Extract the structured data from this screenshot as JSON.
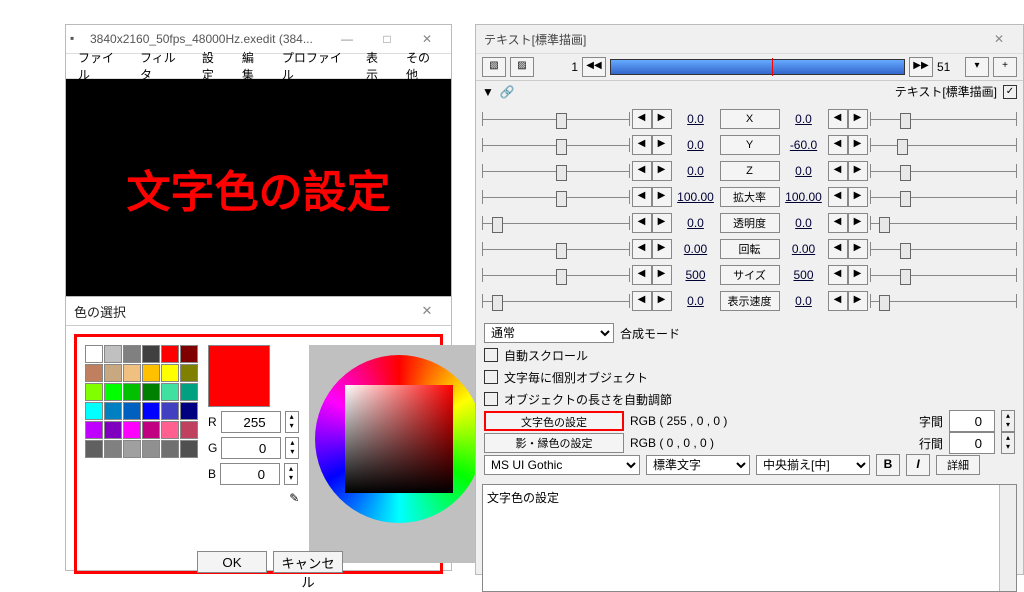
{
  "main": {
    "title": "3840x2160_50fps_48000Hz.exedit (384...",
    "menu": [
      "ファイル",
      "フィルタ",
      "設定",
      "編集",
      "プロファイル",
      "表示",
      "その他"
    ],
    "preview_text": "文字色の設定"
  },
  "color": {
    "title": "色の選択",
    "r_label": "R",
    "g_label": "G",
    "b_label": "B",
    "r": "255",
    "g": "0",
    "b": "0",
    "ok": "OK",
    "cancel": "キャンセル",
    "swatches": [
      "#ffffff",
      "#c0c0c0",
      "#808080",
      "#404040",
      "#ff0000",
      "#800000",
      "#c08060",
      "#c8a880",
      "#f0c080",
      "#ffc000",
      "#ffff00",
      "#808000",
      "#80ff00",
      "#00ff00",
      "#00c000",
      "#008000",
      "#40e0a0",
      "#00a080",
      "#00ffff",
      "#0080c0",
      "#0060c0",
      "#0000ff",
      "#4040c0",
      "#000080",
      "#c000ff",
      "#8000c0",
      "#ff00ff",
      "#c00080",
      "#ff6090",
      "#c04060",
      "#606060",
      "#808080",
      "#a0a0a0",
      "#909090",
      "#707070",
      "#505050"
    ]
  },
  "text": {
    "title": "テキスト[標準描画]",
    "frame_start": "1",
    "frame_end": "51",
    "section_label": "テキスト[標準描画]",
    "params": [
      {
        "l": "0.0",
        "name": "X",
        "r": "0.0",
        "lp": 50,
        "rp": 20
      },
      {
        "l": "0.0",
        "name": "Y",
        "r": "-60.0",
        "lp": 50,
        "rp": 18
      },
      {
        "l": "0.0",
        "name": "Z",
        "r": "0.0",
        "lp": 50,
        "rp": 20
      },
      {
        "l": "100.00",
        "name": "拡大率",
        "r": "100.00",
        "lp": 50,
        "rp": 20
      },
      {
        "l": "0.0",
        "name": "透明度",
        "r": "0.0",
        "lp": 6,
        "rp": 6
      },
      {
        "l": "0.00",
        "name": "回転",
        "r": "0.00",
        "lp": 50,
        "rp": 20
      },
      {
        "l": "500",
        "name": "サイズ",
        "r": "500",
        "lp": 50,
        "rp": 20
      },
      {
        "l": "0.0",
        "name": "表示速度",
        "r": "0.0",
        "lp": 6,
        "rp": 6
      }
    ],
    "blend_sel": "通常",
    "blend_label": "合成モード",
    "checks": [
      "自動スクロール",
      "文字毎に個別オブジェクト",
      "オブジェクトの長さを自動調節"
    ],
    "text_color_btn": "文字色の設定",
    "text_color_val": "RGB ( 255 , 0 , 0 )",
    "shadow_btn": "影・縁色の設定",
    "shadow_val": "RGB ( 0 , 0 , 0 )",
    "spacing_label": "字間",
    "spacing": "0",
    "line_label": "行間",
    "line": "0",
    "font": "MS UI Gothic",
    "weight": "標準文字",
    "align": "中央揃え[中]",
    "bold": "B",
    "italic": "I",
    "detail": "詳細",
    "textarea": "文字色の設定"
  }
}
